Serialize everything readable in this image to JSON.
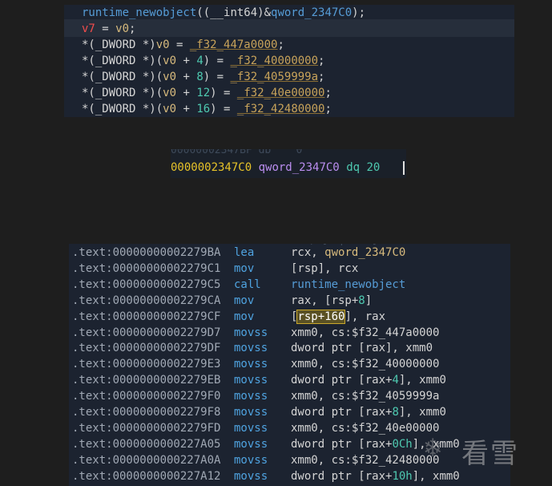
{
  "pseudocode": {
    "lines": [
      {
        "parts": [
          [
            "fn",
            "runtime_newobject"
          ],
          [
            "plain",
            "((__int64)&"
          ],
          [
            "fn",
            "qword_2347C0"
          ],
          [
            "plain",
            ");"
          ]
        ]
      },
      {
        "parts": [
          [
            "red",
            "v7"
          ],
          [
            "plain",
            " = "
          ],
          [
            "var",
            "v0"
          ],
          [
            "plain",
            ";"
          ]
        ]
      },
      {
        "parts": [
          [
            "plain",
            "*(_DWORD *)"
          ],
          [
            "var",
            "v0"
          ],
          [
            "plain",
            " = "
          ],
          [
            "gold",
            "_f32_447a0000"
          ],
          [
            "plain",
            ";"
          ]
        ]
      },
      {
        "parts": [
          [
            "plain",
            "*(_DWORD *)("
          ],
          [
            "var",
            "v0"
          ],
          [
            "plain",
            " + "
          ],
          [
            "num",
            "4"
          ],
          [
            "plain",
            ") = "
          ],
          [
            "gold",
            "_f32_40000000"
          ],
          [
            "plain",
            ";"
          ]
        ]
      },
      {
        "parts": [
          [
            "plain",
            "*(_DWORD *)("
          ],
          [
            "var",
            "v0"
          ],
          [
            "plain",
            " + "
          ],
          [
            "num",
            "8"
          ],
          [
            "plain",
            ") = "
          ],
          [
            "gold",
            "_f32_4059999a"
          ],
          [
            "plain",
            ";"
          ]
        ]
      },
      {
        "parts": [
          [
            "plain",
            "*(_DWORD *)("
          ],
          [
            "var",
            "v0"
          ],
          [
            "plain",
            " + "
          ],
          [
            "num",
            "12"
          ],
          [
            "plain",
            ") = "
          ],
          [
            "gold",
            "_f32_40e00000"
          ],
          [
            "plain",
            ";"
          ]
        ]
      },
      {
        "parts": [
          [
            "plain",
            "*(_DWORD *)("
          ],
          [
            "var",
            "v0"
          ],
          [
            "plain",
            " + "
          ],
          [
            "num",
            "16"
          ],
          [
            "plain",
            ") = "
          ],
          [
            "gold",
            "_f32_42480000"
          ],
          [
            "plain",
            ";"
          ]
        ]
      }
    ]
  },
  "data_view": {
    "ghost": "00000002347BF db    0",
    "address": "0000002347C0",
    "label": "qword_2347C0",
    "directive": "dq",
    "value": "20"
  },
  "disassembly": {
    "rows": [
      {
        "seg": ".text:00000000002279BA",
        "mn": "lea",
        "op": [
          [
            "plain",
            "rcx, "
          ],
          [
            "csym",
            "qword_2347C0"
          ]
        ]
      },
      {
        "seg": ".text:00000000002279C1",
        "mn": "mov",
        "op": [
          [
            "plain",
            "[rsp], rcx"
          ]
        ]
      },
      {
        "seg": ".text:00000000002279C5",
        "mn": "call",
        "op": [
          [
            "fnb",
            "runtime_newobject"
          ]
        ]
      },
      {
        "seg": ".text:00000000002279CA",
        "mn": "mov",
        "op": [
          [
            "plain",
            "rax, [rsp+"
          ],
          [
            "grn",
            "8"
          ],
          [
            "plain",
            "]"
          ]
        ]
      },
      {
        "seg": ".text:00000000002279CF",
        "mn": "mov",
        "op": [
          [
            "plain",
            "["
          ],
          [
            "hl",
            "rsp+160"
          ],
          [
            "plain",
            "], rax"
          ]
        ]
      },
      {
        "seg": ".text:00000000002279D7",
        "mn": "movss",
        "op": [
          [
            "plain",
            "xmm0, cs:$f32_447a0000"
          ]
        ]
      },
      {
        "seg": ".text:00000000002279DF",
        "mn": "movss",
        "op": [
          [
            "plain",
            "dword ptr [rax], xmm0"
          ]
        ]
      },
      {
        "seg": ".text:00000000002279E3",
        "mn": "movss",
        "op": [
          [
            "plain",
            "xmm0, cs:$f32_40000000"
          ]
        ]
      },
      {
        "seg": ".text:00000000002279EB",
        "mn": "movss",
        "op": [
          [
            "plain",
            "dword ptr [rax+"
          ],
          [
            "grn",
            "4"
          ],
          [
            "plain",
            "], xmm0"
          ]
        ]
      },
      {
        "seg": ".text:00000000002279F0",
        "mn": "movss",
        "op": [
          [
            "plain",
            "xmm0, cs:$f32_4059999a"
          ]
        ]
      },
      {
        "seg": ".text:00000000002279F8",
        "mn": "movss",
        "op": [
          [
            "plain",
            "dword ptr [rax+"
          ],
          [
            "grn",
            "8"
          ],
          [
            "plain",
            "], xmm0"
          ]
        ]
      },
      {
        "seg": ".text:00000000002279FD",
        "mn": "movss",
        "op": [
          [
            "plain",
            "xmm0, cs:$f32_40e00000"
          ]
        ]
      },
      {
        "seg": ".text:0000000000227A05",
        "mn": "movss",
        "op": [
          [
            "plain",
            "dword ptr [rax+"
          ],
          [
            "grn",
            "0Ch"
          ],
          [
            "plain",
            "], xmm0"
          ]
        ]
      },
      {
        "seg": ".text:0000000000227A0A",
        "mn": "movss",
        "op": [
          [
            "plain",
            "xmm0, cs:$f32_42480000"
          ]
        ]
      },
      {
        "seg": ".text:0000000000227A12",
        "mn": "movss",
        "op": [
          [
            "plain",
            "dword ptr [rax+"
          ],
          [
            "grn",
            "10h"
          ],
          [
            "plain",
            "], xmm0"
          ]
        ]
      }
    ]
  },
  "watermark": {
    "text": "看雪"
  }
}
